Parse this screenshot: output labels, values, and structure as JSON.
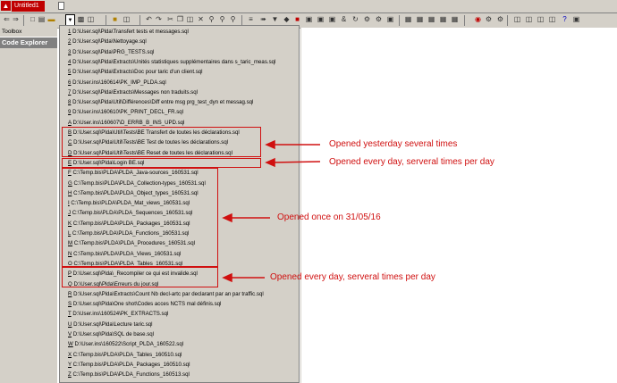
{
  "window": {
    "tab_title": "Untitled1"
  },
  "sidebar": {
    "toolbox_label": "Toolbox",
    "explorer_title": "Code Explorer"
  },
  "menu_items": [
    {
      "key": "1",
      "path": "D:\\User.sql\\Plda\\Transfert tests et messages.sql"
    },
    {
      "key": "2",
      "path": "D:\\User.sql\\Plda\\Nettoyage.sql"
    },
    {
      "key": "3",
      "path": "D:\\User.sql\\Plda\\PRG_TESTS.sql"
    },
    {
      "key": "4",
      "path": "D:\\User.sql\\Plda\\Extracts\\Unités statistiques supplémentaires dans s_taric_meas.sql"
    },
    {
      "key": "5",
      "path": "D:\\User.sql\\Plda\\Extracts\\Doc pour taric d'un client.sql"
    },
    {
      "key": "6",
      "path": "D:\\User.ins\\160614\\PK_IMP_PLDA.sql"
    },
    {
      "key": "7",
      "path": "D:\\User.sql\\Plda\\Extracts\\Messages non traduits.sql"
    },
    {
      "key": "8",
      "path": "D:\\User.sql\\Plda\\Util\\Différences\\Diff entre msg prg_test_dyn et messag.sql"
    },
    {
      "key": "9",
      "path": "D:\\User.ins\\160610\\PK_PRINT_DECL_FR.sql"
    },
    {
      "key": "A",
      "path": "D:\\User.ins\\160607\\D_ERRB_B_INS_UPD.sql"
    },
    {
      "key": "B",
      "path": "D:\\User.sql\\Plda\\Util\\Tests\\BE Transfert de toutes les déclarations.sql"
    },
    {
      "key": "C",
      "path": "D:\\User.sql\\Plda\\Util\\Tests\\BE Test de toutes les déclarations.sql"
    },
    {
      "key": "D",
      "path": "D:\\User.sql\\Plda\\Util\\Tests\\BE Reset de toutes les déclarations.sql"
    },
    {
      "key": "E",
      "path": "D:\\User.sql\\Plda\\Login BE.sql"
    },
    {
      "key": "F",
      "path": "C:\\Temp.bis\\PLDA\\PLDA_Java-sources_160531.sql"
    },
    {
      "key": "G",
      "path": "C:\\Temp.bis\\PLDA\\PLDA_Collection-types_160531.sql"
    },
    {
      "key": "H",
      "path": "C:\\Temp.bis\\PLDA\\PLDA_Object_types_160531.sql"
    },
    {
      "key": "I",
      "path": "C:\\Temp.bis\\PLDA\\PLDA_Mat_views_160531.sql"
    },
    {
      "key": "J",
      "path": "C:\\Temp.bis\\PLDA\\PLDA_Sequences_160531.sql"
    },
    {
      "key": "K",
      "path": "C:\\Temp.bis\\PLDA\\PLDA_Packages_160531.sql"
    },
    {
      "key": "L",
      "path": "C:\\Temp.bis\\PLDA\\PLDA_Functions_160531.sql"
    },
    {
      "key": "M",
      "path": "C:\\Temp.bis\\PLDA\\PLDA_Procedures_160531.sql"
    },
    {
      "key": "N",
      "path": "C:\\Temp.bis\\PLDA\\PLDA_Views_160531.sql"
    },
    {
      "key": "O",
      "path": "C:\\Temp.bis\\PLDA\\PLDA_Tables_160531.sql"
    },
    {
      "key": "P",
      "path": "D:\\User.sql\\Plda\\_Recompiler ce qui est invalide.sql"
    },
    {
      "key": "Q",
      "path": "D:\\User.sql\\Plda\\Erreurs du jour.sql"
    },
    {
      "key": "R",
      "path": "D:\\User.sql\\Plda\\Extracts\\Count Nb decl-artc par declarant par an par traffic.sql"
    },
    {
      "key": "S",
      "path": "D:\\User.sql\\Plda\\One shot\\Codes acces NCTS mal définis.sql"
    },
    {
      "key": "T",
      "path": "D:\\User.ins\\160524\\PK_EXTRACTS.sql"
    },
    {
      "key": "U",
      "path": "D:\\User.sql\\Plda\\Lecture taric.sql"
    },
    {
      "key": "V",
      "path": "D:\\User.sql\\Plda\\SQL de base.sql"
    },
    {
      "key": "W",
      "path": "D:\\User.ins\\160522\\Script_PLDA_160522.sql"
    },
    {
      "key": "X",
      "path": "C:\\Temp.bis\\PLDA\\PLDA_Tables_160510.sql"
    },
    {
      "key": "Y",
      "path": "C:\\Temp.bis\\PLDA\\PLDA_Packages_160510.sql"
    },
    {
      "key": "Z",
      "path": "C:\\Temp.bis\\PLDA\\PLDA_Functions_160513.sql"
    }
  ],
  "annotations": {
    "yesterday": "Opened yesterday several times",
    "every_day_1": "Opened every day, serveral times per day",
    "once": "Opened once on 31/05/16",
    "every_day_2": "Opened every day, serveral times per day"
  },
  "colors": {
    "annotation": "#d01010",
    "tab": "#c00000",
    "chrome": "#d4d0c8"
  }
}
